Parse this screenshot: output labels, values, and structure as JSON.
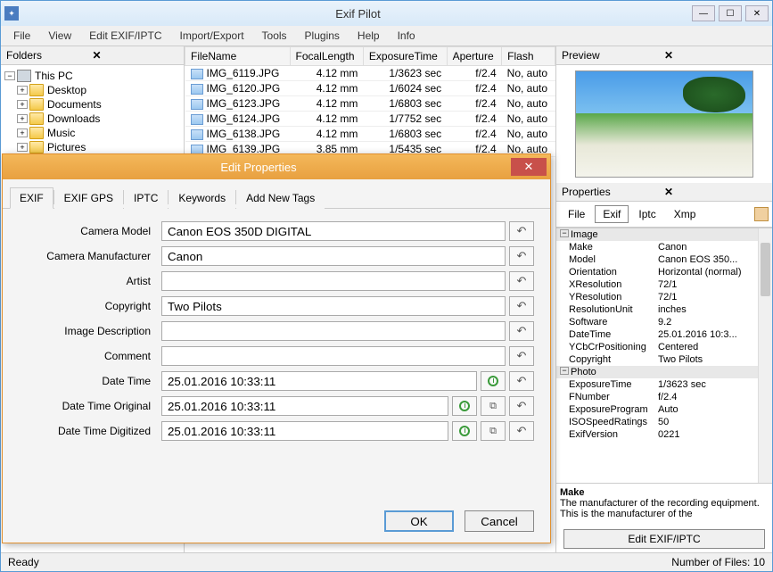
{
  "app": {
    "title": "Exif Pilot"
  },
  "menu": [
    "File",
    "View",
    "Edit EXIF/IPTC",
    "Import/Export",
    "Tools",
    "Plugins",
    "Help",
    "Info"
  ],
  "folders": {
    "header": "Folders",
    "root": "This PC",
    "items": [
      "Desktop",
      "Documents",
      "Downloads",
      "Music",
      "Pictures"
    ]
  },
  "file_table": {
    "columns": [
      "FileName",
      "FocalLength",
      "ExposureTime",
      "Aperture",
      "Flash"
    ],
    "rows": [
      {
        "name": "IMG_6119.JPG",
        "fl": "4.12 mm",
        "et": "1/3623 sec",
        "ap": "f/2.4",
        "flash": "No, auto"
      },
      {
        "name": "IMG_6120.JPG",
        "fl": "4.12 mm",
        "et": "1/6024 sec",
        "ap": "f/2.4",
        "flash": "No, auto"
      },
      {
        "name": "IMG_6123.JPG",
        "fl": "4.12 mm",
        "et": "1/6803 sec",
        "ap": "f/2.4",
        "flash": "No, auto"
      },
      {
        "name": "IMG_6124.JPG",
        "fl": "4.12 mm",
        "et": "1/7752 sec",
        "ap": "f/2.4",
        "flash": "No, auto"
      },
      {
        "name": "IMG_6138.JPG",
        "fl": "4.12 mm",
        "et": "1/6803 sec",
        "ap": "f/2.4",
        "flash": "No, auto"
      },
      {
        "name": "IMG_6139.JPG",
        "fl": "3.85 mm",
        "et": "1/5435 sec",
        "ap": "f/2.4",
        "flash": "No, auto"
      }
    ]
  },
  "preview": {
    "header": "Preview"
  },
  "properties": {
    "header": "Properties",
    "tabs": [
      "File",
      "Exif",
      "Iptc",
      "Xmp"
    ],
    "active_tab": "Exif",
    "groups": [
      {
        "name": "Image",
        "items": [
          {
            "k": "Make",
            "v": "Canon"
          },
          {
            "k": "Model",
            "v": "Canon EOS 350..."
          },
          {
            "k": "Orientation",
            "v": "Horizontal (normal)"
          },
          {
            "k": "XResolution",
            "v": "72/1"
          },
          {
            "k": "YResolution",
            "v": "72/1"
          },
          {
            "k": "ResolutionUnit",
            "v": "inches"
          },
          {
            "k": "Software",
            "v": "9.2"
          },
          {
            "k": "DateTime",
            "v": "25.01.2016 10:3..."
          },
          {
            "k": "YCbCrPositioning",
            "v": "Centered"
          },
          {
            "k": "Copyright",
            "v": "Two Pilots"
          }
        ]
      },
      {
        "name": "Photo",
        "items": [
          {
            "k": "ExposureTime",
            "v": "1/3623 sec"
          },
          {
            "k": "FNumber",
            "v": "f/2.4"
          },
          {
            "k": "ExposureProgram",
            "v": "Auto"
          },
          {
            "k": "ISOSpeedRatings",
            "v": "50"
          },
          {
            "k": "ExifVersion",
            "v": "0221"
          }
        ]
      }
    ],
    "desc_title": "Make",
    "desc_text": "The manufacturer of the recording equipment. This is the manufacturer of the",
    "edit_button": "Edit EXIF/IPTC"
  },
  "status": {
    "left": "Ready",
    "right": "Number of Files: 10"
  },
  "dialog": {
    "title": "Edit Properties",
    "tabs": [
      "EXIF",
      "EXIF GPS",
      "IPTC",
      "Keywords",
      "Add New Tags"
    ],
    "fields": [
      {
        "label": "Camera Model",
        "value": "Canon EOS 350D DIGITAL",
        "buttons": [
          "undo"
        ]
      },
      {
        "label": "Camera Manufacturer",
        "value": "Canon",
        "buttons": [
          "undo"
        ]
      },
      {
        "label": "Artist",
        "value": "",
        "buttons": [
          "undo"
        ]
      },
      {
        "label": "Copyright",
        "value": "Two Pilots",
        "buttons": [
          "undo"
        ]
      },
      {
        "label": "Image Description",
        "value": "",
        "buttons": [
          "undo"
        ]
      },
      {
        "label": "Comment",
        "value": "",
        "buttons": [
          "undo"
        ]
      },
      {
        "label": "Date Time",
        "value": "25.01.2016 10:33:11",
        "buttons": [
          "clock",
          "undo"
        ]
      },
      {
        "label": "Date Time Original",
        "value": "25.01.2016 10:33:11",
        "buttons": [
          "clock",
          "copy",
          "undo"
        ]
      },
      {
        "label": "Date Time Digitized",
        "value": "25.01.2016 10:33:11",
        "buttons": [
          "clock",
          "copy",
          "undo"
        ]
      }
    ],
    "ok": "OK",
    "cancel": "Cancel"
  }
}
